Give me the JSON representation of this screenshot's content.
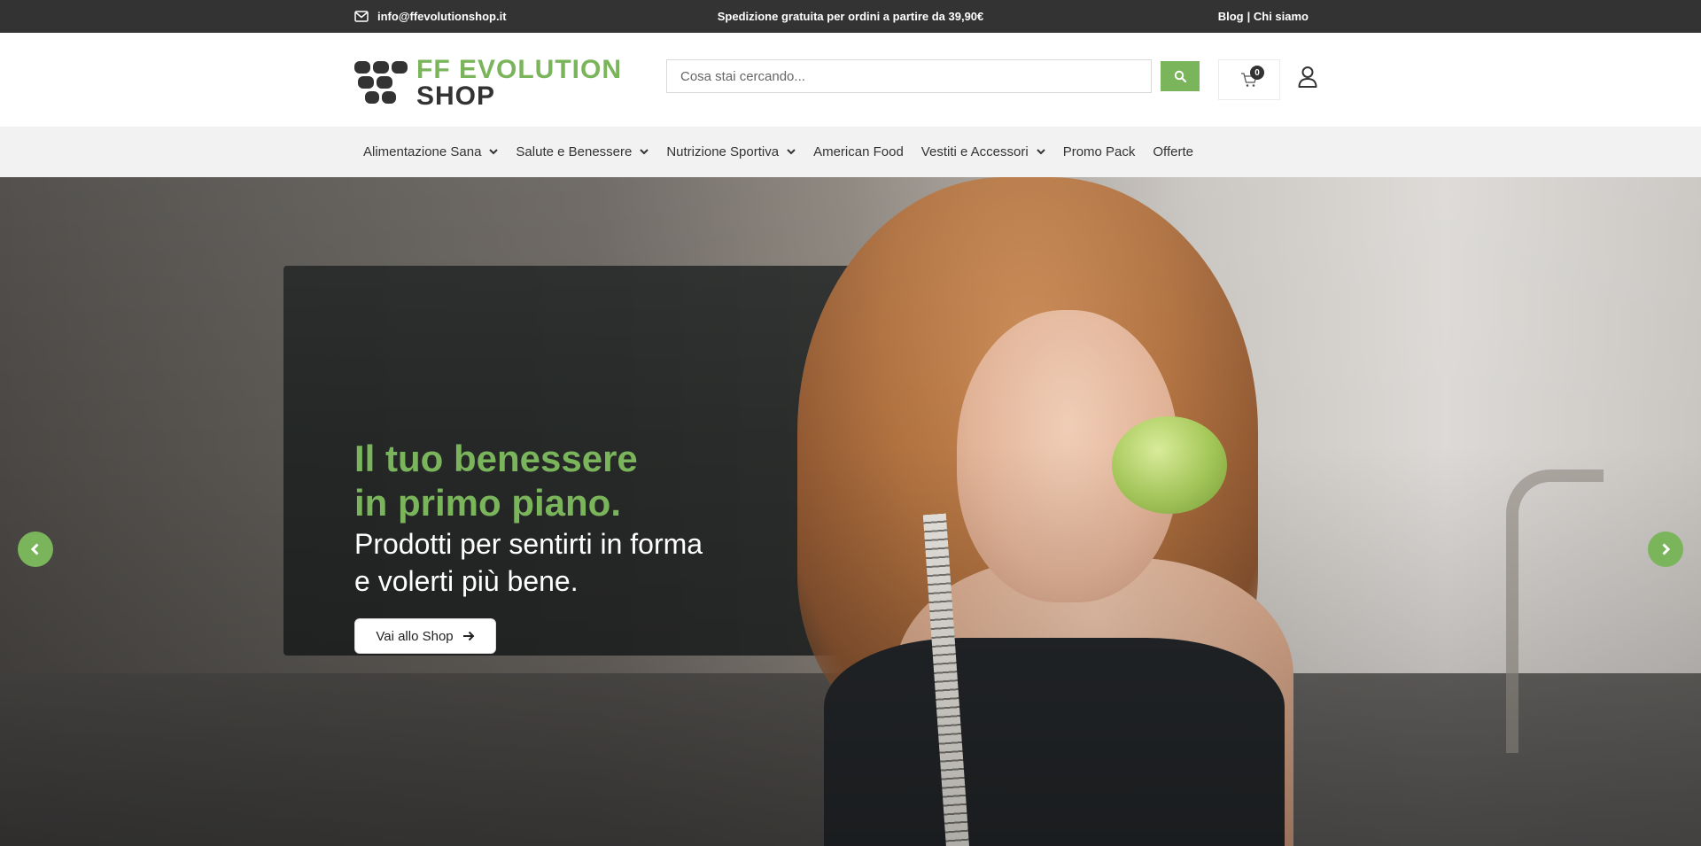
{
  "topbar": {
    "email": "info@ffevolutionshop.it",
    "shipping": "Spedizione gratuita per ordini a partire da 39,90€",
    "link_blog": "Blog",
    "link_about": "| Chi siamo"
  },
  "header": {
    "logo_line1": "FF EVOLUTION",
    "logo_line2": "SHOP",
    "search_placeholder": "Cosa stai cercando...",
    "cart_count": "0"
  },
  "nav": {
    "items": [
      {
        "label": "Alimentazione Sana",
        "has_dropdown": true
      },
      {
        "label": "Salute e Benessere",
        "has_dropdown": true
      },
      {
        "label": "Nutrizione Sportiva",
        "has_dropdown": true
      },
      {
        "label": "American Food",
        "has_dropdown": false
      },
      {
        "label": "Vestiti e Accessori",
        "has_dropdown": true
      },
      {
        "label": "Promo Pack",
        "has_dropdown": false
      },
      {
        "label": "Offerte",
        "has_dropdown": false
      }
    ]
  },
  "hero": {
    "title_line1": "Il tuo benessere",
    "title_line2": "in primo piano.",
    "subtitle_line1": "Prodotti per sentirti in forma",
    "subtitle_line2": "e volerti più bene.",
    "cta_label": "Vai allo Shop"
  },
  "colors": {
    "brand_green": "#7ab55c",
    "dark": "#333333",
    "nav_bg": "#f2f2f2"
  },
  "icons": {
    "email": "envelope-icon",
    "search": "search-icon",
    "cart": "cart-icon",
    "user": "user-icon",
    "prev": "chevron-left-icon",
    "next": "chevron-right-icon",
    "cta_arrow": "arrow-right-icon"
  }
}
